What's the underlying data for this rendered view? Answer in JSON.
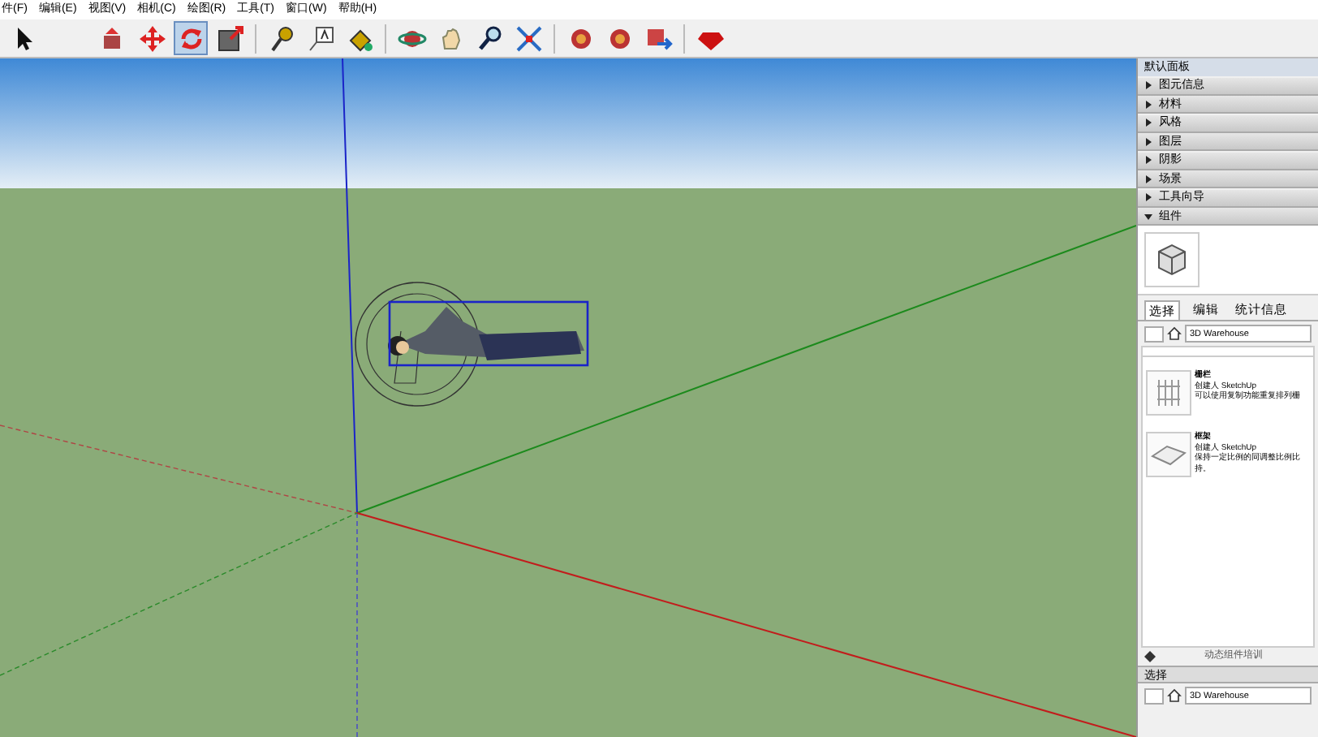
{
  "menu_bar": [
    "件(F)",
    "编辑(E)",
    "视图(V)",
    "相机(C)",
    "绘图(R)",
    "工具(T)",
    "窗口(W)",
    "帮助(H)"
  ],
  "toolbar": {
    "groups": [
      [
        {
          "kind": "arrow",
          "selected": false
        },
        {
          "kind": "push",
          "selected": false
        },
        {
          "kind": "move",
          "selected": false
        },
        {
          "kind": "rotate",
          "selected": true
        },
        {
          "kind": "scale",
          "selected": false
        }
      ],
      [
        {
          "kind": "tape",
          "selected": false
        },
        {
          "kind": "text",
          "selected": false
        },
        {
          "kind": "paint",
          "selected": false
        }
      ],
      [
        {
          "kind": "orbit",
          "selected": false
        },
        {
          "kind": "pan",
          "selected": false
        },
        {
          "kind": "zoom",
          "selected": false
        },
        {
          "kind": "extents",
          "selected": false
        }
      ],
      [
        {
          "kind": "blob",
          "selected": false
        },
        {
          "kind": "blob",
          "selected": false
        },
        {
          "kind": "share",
          "selected": false
        }
      ],
      [
        {
          "kind": "gem",
          "selected": false
        }
      ]
    ]
  },
  "tray": {
    "title": "默认面板",
    "sections": [
      {
        "label": "图元信息",
        "expanded": false
      },
      {
        "label": "材料",
        "expanded": false
      },
      {
        "label": "风格",
        "expanded": false
      },
      {
        "label": "图层",
        "expanded": false
      },
      {
        "label": "阴影",
        "expanded": false
      },
      {
        "label": "场景",
        "expanded": false
      },
      {
        "label": "工具向导",
        "expanded": false
      },
      {
        "label": "组件",
        "expanded": true
      }
    ],
    "tabs": [
      {
        "label": "选择",
        "selected": true
      },
      {
        "label": "编辑",
        "selected": false
      },
      {
        "label": "统计信息",
        "selected": false
      }
    ],
    "search": {
      "value": "3D Warehouse"
    },
    "components": [
      {
        "kind": "fence",
        "name": "栅栏",
        "author": "创建人 SketchUp",
        "description": "可以使用复制功能重复排列栅"
      },
      {
        "kind": "frame",
        "name": "框架",
        "author": "创建人 SketchUp",
        "description": "保持一定比例的同调整比例比",
        "more": "持。"
      }
    ],
    "footer_link": "动态组件培训",
    "second_section": {
      "title": "选择",
      "search": {
        "value": "3D Warehouse"
      }
    }
  }
}
